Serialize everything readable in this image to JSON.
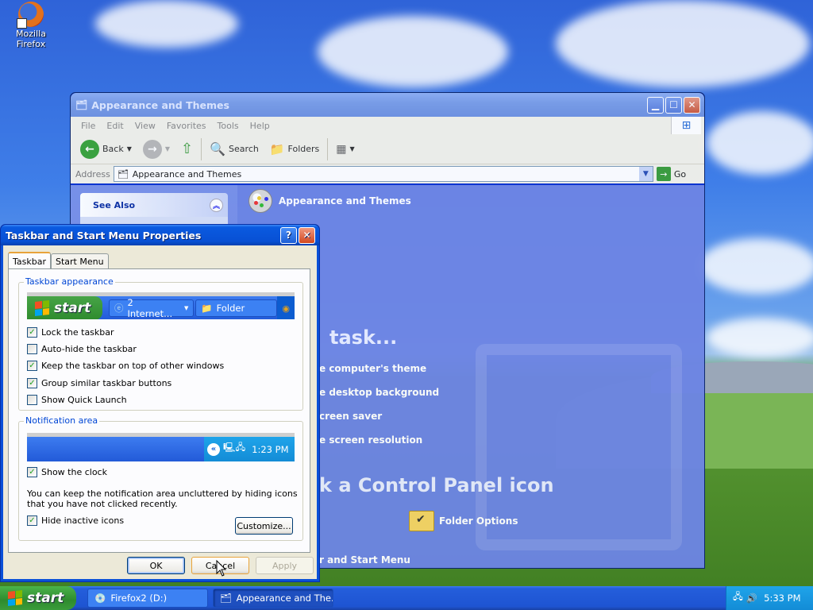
{
  "desktop": {
    "icons": [
      {
        "label": "Mozilla Firefox",
        "icon": "firefox-icon"
      }
    ]
  },
  "explorer": {
    "title": "Appearance and Themes",
    "menu": [
      "File",
      "Edit",
      "View",
      "Favorites",
      "Tools",
      "Help"
    ],
    "toolbar": {
      "back": "Back",
      "search": "Search",
      "folders": "Folders"
    },
    "address_label": "Address",
    "address_value": "Appearance and Themes",
    "go": "Go",
    "see_also": "See Also",
    "header": "Appearance and Themes",
    "pick_task": "task...",
    "tasks": [
      "e computer's theme",
      "e desktop background",
      "creen saver",
      "e screen resolution"
    ],
    "pick_icon": "k a Control Panel icon",
    "icons": [
      "Folder Options",
      "r and Start Menu"
    ]
  },
  "dialog": {
    "title": "Taskbar and Start Menu Properties",
    "tabs": [
      "Taskbar",
      "Start Menu"
    ],
    "group1": {
      "label": "Taskbar appearance",
      "preview": {
        "start": "start",
        "btn1": "2 Internet...",
        "btn2": "Folder"
      },
      "options": [
        {
          "label": "Lock the taskbar",
          "checked": true
        },
        {
          "label": "Auto-hide the taskbar",
          "checked": false
        },
        {
          "label": "Keep the taskbar on top of other windows",
          "checked": true
        },
        {
          "label": "Group similar taskbar buttons",
          "checked": true
        },
        {
          "label": "Show Quick Launch",
          "checked": false
        }
      ]
    },
    "group2": {
      "label": "Notification area",
      "preview_time": "1:23 PM",
      "show_clock": {
        "label": "Show the clock",
        "checked": true
      },
      "description": "You can keep the notification area uncluttered by hiding icons that you have not clicked recently.",
      "hide_inactive": {
        "label": "Hide inactive icons",
        "checked": true
      },
      "customize": "Customize..."
    },
    "buttons": {
      "ok": "OK",
      "cancel": "Cancel",
      "apply": "Apply"
    }
  },
  "taskbar": {
    "start": "start",
    "tasks": [
      {
        "label": "Firefox2 (D:)",
        "active": false
      },
      {
        "label": "Appearance and The...",
        "active": true
      }
    ],
    "clock": "5:33 PM"
  },
  "colors": {
    "xp_blue": "#0a50d8",
    "taskbar_blue": "#245edb",
    "start_green": "#3a9c3a",
    "tray_blue": "#138cd6"
  }
}
